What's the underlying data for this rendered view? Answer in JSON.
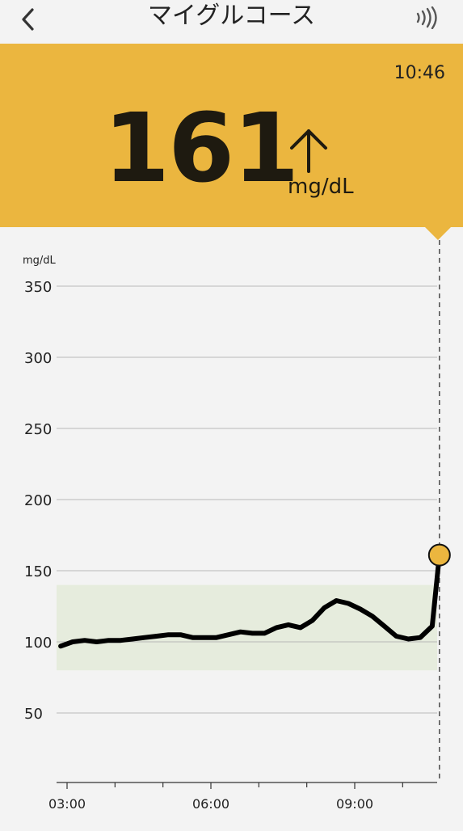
{
  "header": {
    "title": "マイグルコース",
    "back_icon": "chevron-left-icon",
    "nfc_icon": "nfc-scan-icon"
  },
  "reading": {
    "time": "10:46",
    "value": "161",
    "unit": "mg/dL",
    "trend": "rising",
    "trend_icon": "arrow-up-icon",
    "color": "#ebb63f"
  },
  "chart_data": {
    "type": "line",
    "ylabel": "mg/dL",
    "ylim": [
      0,
      350
    ],
    "yticks": [
      350,
      300,
      250,
      200,
      150,
      100,
      50
    ],
    "xlim": [
      "02:52",
      "10:46"
    ],
    "xticks": [
      "03:00",
      "06:00",
      "09:00"
    ],
    "target_range": [
      80,
      140
    ],
    "target_range_color": "#e6ecdd",
    "line_color": "#000000",
    "current_marker_color": "#ebb63f",
    "grid": true,
    "series": [
      {
        "x": [
          "02:52",
          "03:07",
          "03:22",
          "03:37",
          "03:52",
          "04:07",
          "04:22",
          "04:37",
          "04:52",
          "05:07",
          "05:22",
          "05:37",
          "05:52",
          "06:07",
          "06:22",
          "06:37",
          "06:52",
          "07:07",
          "07:22",
          "07:37",
          "07:52",
          "08:07",
          "08:22",
          "08:37",
          "08:52",
          "09:07",
          "09:22",
          "09:37",
          "09:52",
          "10:07",
          "10:22",
          "10:37",
          "10:46"
        ],
        "values": [
          97,
          100,
          101,
          100,
          101,
          101,
          102,
          103,
          104,
          105,
          105,
          103,
          103,
          103,
          105,
          107,
          106,
          106,
          110,
          112,
          110,
          115,
          124,
          129,
          127,
          123,
          118,
          111,
          104,
          102,
          103,
          111,
          161
        ]
      }
    ]
  }
}
